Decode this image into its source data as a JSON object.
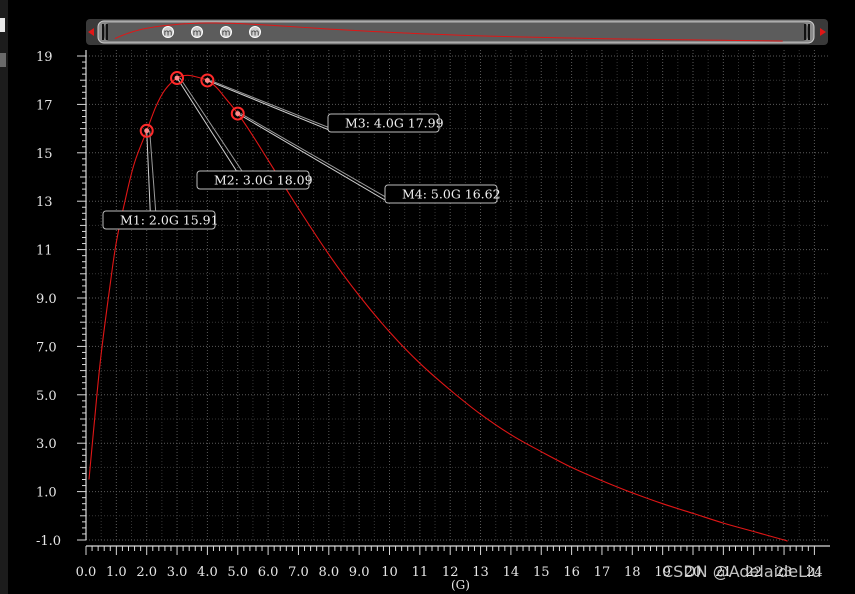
{
  "chart_data": {
    "type": "line",
    "xlabel": "(G)",
    "ylabel": "",
    "xlim": [
      0,
      24
    ],
    "ylim": [
      -1,
      19
    ],
    "x_ticks": [
      "0.0",
      "1.0",
      "2.0",
      "3.0",
      "4.0",
      "5.0",
      "6.0",
      "7.0",
      "8.0",
      "9.0",
      "10",
      "11",
      "12",
      "13",
      "14",
      "15",
      "16",
      "17",
      "18",
      "19",
      "20",
      "21",
      "22",
      "23",
      "24"
    ],
    "y_ticks": [
      "-1.0",
      "1.0",
      "3.0",
      "5.0",
      "7.0",
      "9.0",
      "11",
      "13",
      "15",
      "17",
      "19"
    ],
    "grid": true,
    "series": [
      {
        "color": "#e01616",
        "x": [
          0.1,
          0.3,
          0.5,
          0.8,
          1.0,
          1.3,
          1.6,
          2.0,
          2.3,
          2.6,
          3.0,
          3.3,
          3.6,
          4.0,
          4.3,
          4.6,
          5.0,
          5.5,
          6.0,
          7.0,
          8.0,
          9.0,
          10,
          11,
          12,
          13,
          14,
          15,
          16,
          17,
          18,
          19,
          20,
          21,
          22,
          23,
          23.1
        ],
        "y": [
          1.5,
          4.2,
          6.7,
          9.6,
          11.3,
          13.1,
          14.6,
          15.91,
          16.9,
          17.6,
          18.09,
          18.2,
          18.15,
          17.99,
          17.7,
          17.25,
          16.62,
          15.7,
          14.7,
          12.7,
          10.8,
          9.1,
          7.6,
          6.3,
          5.2,
          4.2,
          3.35,
          2.65,
          2.0,
          1.45,
          0.95,
          0.5,
          0.1,
          -0.3,
          -0.65,
          -1.0,
          -1.05
        ]
      }
    ],
    "markers": [
      {
        "id": "M1",
        "x": 2.0,
        "y": 15.91,
        "label": "M1: 2.0G 15.91"
      },
      {
        "id": "M2",
        "x": 3.0,
        "y": 18.09,
        "label": "M2: 3.0G 18.09"
      },
      {
        "id": "M3",
        "x": 4.0,
        "y": 17.99,
        "label": "M3: 4.0G 17.99"
      },
      {
        "id": "M4",
        "x": 5.0,
        "y": 16.62,
        "label": "M4: 5.0G 16.62"
      }
    ]
  },
  "navigator": {
    "marker_glyph": "m"
  },
  "watermark": "CSDN @AdelaideLiu"
}
